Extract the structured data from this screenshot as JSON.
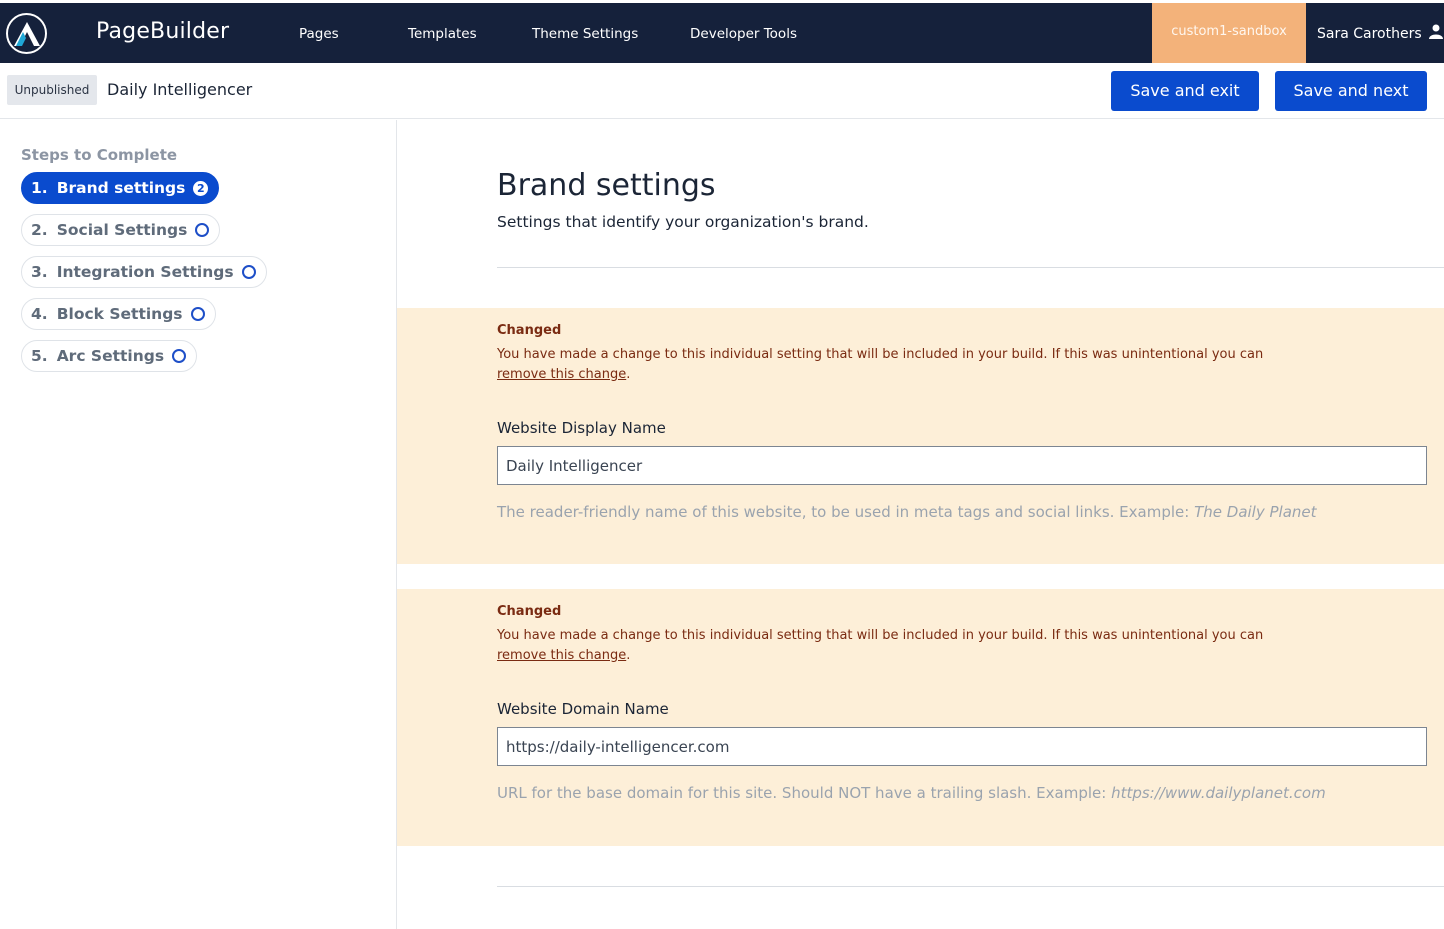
{
  "app": {
    "brand": "PageBuilder",
    "logo_icon": "arc-logo-icon",
    "nav": [
      "Pages",
      "Templates",
      "Theme Settings",
      "Developer Tools"
    ],
    "environment": "custom1-sandbox",
    "user": "Sara Carothers",
    "user_icon": "user-icon"
  },
  "header": {
    "status_badge": "Unpublished",
    "site_title": "Daily Intelligencer",
    "save_exit": "Save and exit",
    "save_next": "Save and next"
  },
  "sidebar": {
    "title": "Steps to Complete",
    "steps": [
      {
        "num": "1.",
        "label": "Brand settings",
        "count": "2",
        "active": true
      },
      {
        "num": "2.",
        "label": "Social Settings",
        "active": false
      },
      {
        "num": "3.",
        "label": "Integration Settings",
        "active": false
      },
      {
        "num": "4.",
        "label": "Block Settings",
        "active": false
      },
      {
        "num": "5.",
        "label": "Arc Settings",
        "active": false
      }
    ]
  },
  "main": {
    "title": "Brand settings",
    "subtitle": "Settings that identify your organization's brand.",
    "settings": [
      {
        "changed_label": "Changed",
        "changed_message": "You have made a change to this individual setting that will be included in your build. If this was unintentional you can",
        "remove_link": "remove this change",
        "period": ".",
        "field_label": "Website Display Name",
        "value": "Daily Intelligencer",
        "help_text": "The reader-friendly name of this website, to be used in meta tags and social links. Example:",
        "help_example": "The Daily Planet"
      },
      {
        "changed_label": "Changed",
        "changed_message": "You have made a change to this individual setting that will be included in your build. If this was unintentional you can",
        "remove_link": "remove this change",
        "period": ".",
        "field_label": "Website Domain Name",
        "value": "https://daily-intelligencer.com",
        "help_text": "URL for the base domain for this site. Should NOT have a trailing slash. Example:",
        "help_example": "https://www.dailyplanet.com"
      }
    ]
  },
  "colors": {
    "nav_bg": "#15213b",
    "primary": "#0a4bce",
    "sandbox": "#f3b27a",
    "changed_bg": "#fdefd8",
    "changed_text": "#7a2b12"
  }
}
